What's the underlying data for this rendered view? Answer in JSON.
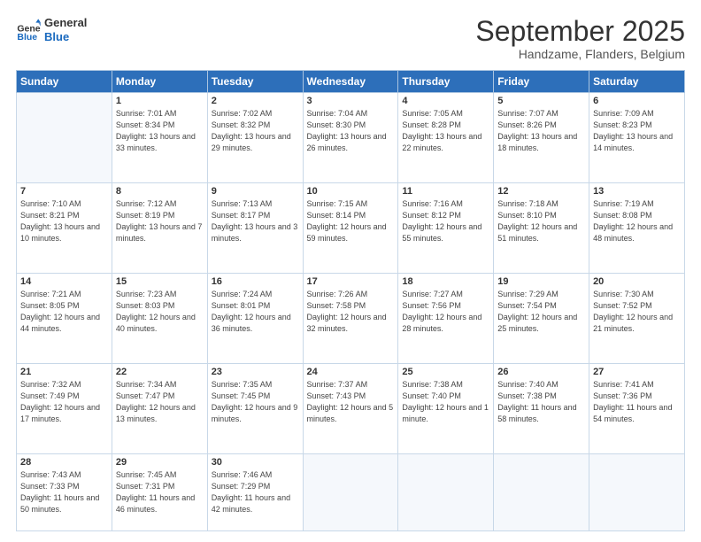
{
  "logo": {
    "line1": "General",
    "line2": "Blue"
  },
  "title": "September 2025",
  "location": "Handzame, Flanders, Belgium",
  "days_header": [
    "Sunday",
    "Monday",
    "Tuesday",
    "Wednesday",
    "Thursday",
    "Friday",
    "Saturday"
  ],
  "weeks": [
    [
      {
        "num": "",
        "info": ""
      },
      {
        "num": "1",
        "info": "Sunrise: 7:01 AM\nSunset: 8:34 PM\nDaylight: 13 hours\nand 33 minutes."
      },
      {
        "num": "2",
        "info": "Sunrise: 7:02 AM\nSunset: 8:32 PM\nDaylight: 13 hours\nand 29 minutes."
      },
      {
        "num": "3",
        "info": "Sunrise: 7:04 AM\nSunset: 8:30 PM\nDaylight: 13 hours\nand 26 minutes."
      },
      {
        "num": "4",
        "info": "Sunrise: 7:05 AM\nSunset: 8:28 PM\nDaylight: 13 hours\nand 22 minutes."
      },
      {
        "num": "5",
        "info": "Sunrise: 7:07 AM\nSunset: 8:26 PM\nDaylight: 13 hours\nand 18 minutes."
      },
      {
        "num": "6",
        "info": "Sunrise: 7:09 AM\nSunset: 8:23 PM\nDaylight: 13 hours\nand 14 minutes."
      }
    ],
    [
      {
        "num": "7",
        "info": "Sunrise: 7:10 AM\nSunset: 8:21 PM\nDaylight: 13 hours\nand 10 minutes."
      },
      {
        "num": "8",
        "info": "Sunrise: 7:12 AM\nSunset: 8:19 PM\nDaylight: 13 hours\nand 7 minutes."
      },
      {
        "num": "9",
        "info": "Sunrise: 7:13 AM\nSunset: 8:17 PM\nDaylight: 13 hours\nand 3 minutes."
      },
      {
        "num": "10",
        "info": "Sunrise: 7:15 AM\nSunset: 8:14 PM\nDaylight: 12 hours\nand 59 minutes."
      },
      {
        "num": "11",
        "info": "Sunrise: 7:16 AM\nSunset: 8:12 PM\nDaylight: 12 hours\nand 55 minutes."
      },
      {
        "num": "12",
        "info": "Sunrise: 7:18 AM\nSunset: 8:10 PM\nDaylight: 12 hours\nand 51 minutes."
      },
      {
        "num": "13",
        "info": "Sunrise: 7:19 AM\nSunset: 8:08 PM\nDaylight: 12 hours\nand 48 minutes."
      }
    ],
    [
      {
        "num": "14",
        "info": "Sunrise: 7:21 AM\nSunset: 8:05 PM\nDaylight: 12 hours\nand 44 minutes."
      },
      {
        "num": "15",
        "info": "Sunrise: 7:23 AM\nSunset: 8:03 PM\nDaylight: 12 hours\nand 40 minutes."
      },
      {
        "num": "16",
        "info": "Sunrise: 7:24 AM\nSunset: 8:01 PM\nDaylight: 12 hours\nand 36 minutes."
      },
      {
        "num": "17",
        "info": "Sunrise: 7:26 AM\nSunset: 7:58 PM\nDaylight: 12 hours\nand 32 minutes."
      },
      {
        "num": "18",
        "info": "Sunrise: 7:27 AM\nSunset: 7:56 PM\nDaylight: 12 hours\nand 28 minutes."
      },
      {
        "num": "19",
        "info": "Sunrise: 7:29 AM\nSunset: 7:54 PM\nDaylight: 12 hours\nand 25 minutes."
      },
      {
        "num": "20",
        "info": "Sunrise: 7:30 AM\nSunset: 7:52 PM\nDaylight: 12 hours\nand 21 minutes."
      }
    ],
    [
      {
        "num": "21",
        "info": "Sunrise: 7:32 AM\nSunset: 7:49 PM\nDaylight: 12 hours\nand 17 minutes."
      },
      {
        "num": "22",
        "info": "Sunrise: 7:34 AM\nSunset: 7:47 PM\nDaylight: 12 hours\nand 13 minutes."
      },
      {
        "num": "23",
        "info": "Sunrise: 7:35 AM\nSunset: 7:45 PM\nDaylight: 12 hours\nand 9 minutes."
      },
      {
        "num": "24",
        "info": "Sunrise: 7:37 AM\nSunset: 7:43 PM\nDaylight: 12 hours\nand 5 minutes."
      },
      {
        "num": "25",
        "info": "Sunrise: 7:38 AM\nSunset: 7:40 PM\nDaylight: 12 hours\nand 1 minute."
      },
      {
        "num": "26",
        "info": "Sunrise: 7:40 AM\nSunset: 7:38 PM\nDaylight: 11 hours\nand 58 minutes."
      },
      {
        "num": "27",
        "info": "Sunrise: 7:41 AM\nSunset: 7:36 PM\nDaylight: 11 hours\nand 54 minutes."
      }
    ],
    [
      {
        "num": "28",
        "info": "Sunrise: 7:43 AM\nSunset: 7:33 PM\nDaylight: 11 hours\nand 50 minutes."
      },
      {
        "num": "29",
        "info": "Sunrise: 7:45 AM\nSunset: 7:31 PM\nDaylight: 11 hours\nand 46 minutes."
      },
      {
        "num": "30",
        "info": "Sunrise: 7:46 AM\nSunset: 7:29 PM\nDaylight: 11 hours\nand 42 minutes."
      },
      {
        "num": "",
        "info": ""
      },
      {
        "num": "",
        "info": ""
      },
      {
        "num": "",
        "info": ""
      },
      {
        "num": "",
        "info": ""
      }
    ]
  ]
}
